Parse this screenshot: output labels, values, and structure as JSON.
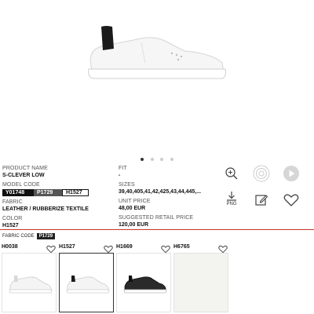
{
  "carousel": {
    "dot_count": 4,
    "active_index": 0
  },
  "product": {
    "name_label": "PRODUCT NAME",
    "name_value": "S-CLEVER LOW",
    "model_label": "MODEL CODE",
    "model_codes": [
      "Y01748",
      "P1729",
      "H1527"
    ],
    "fabric_label": "FABRIC",
    "fabric_value": "LEATHER / RUBBERIZE TEXTILE",
    "color_label": "COLOR",
    "color_value": "H1527",
    "fit_label": "FIT",
    "fit_value": "-",
    "sizes_label": "SIZES",
    "sizes_value": "39,40,405,41,42,425,43,44,445,...",
    "unit_price_label": "UNIT PRICE",
    "unit_price_value": "48,00 EUR",
    "retail_label": "SUGGESTED RETAIL PRICE",
    "retail_value": "120,00 EUR"
  },
  "actions": {
    "zoom_icon": "zoom-in-icon",
    "rotate_icon": "360-view-icon",
    "play_icon": "play-icon",
    "download_icon": "download-png-icon",
    "download_label": "PNG",
    "edit_icon": "edit-note-icon",
    "favorite_icon": "heart-icon"
  },
  "fabric_code": {
    "label": "FABRIC CODE",
    "value": "P1729"
  },
  "swatches": [
    {
      "name": "H0038",
      "selected": false
    },
    {
      "name": "H1527",
      "selected": true
    },
    {
      "name": "H1669",
      "selected": false
    },
    {
      "name": "H6765",
      "selected": false
    }
  ],
  "colors": {
    "divider": "#c0392b",
    "accent": "#111111"
  }
}
